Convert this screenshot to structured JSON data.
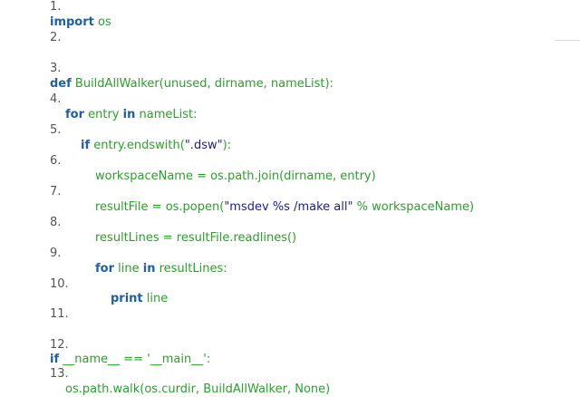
{
  "lines": [
    {
      "num": "1.",
      "parts": [],
      "indent": 0
    },
    {
      "num": "",
      "parts": [
        {
          "t": "import",
          "k": "kw"
        },
        {
          "t": " os",
          "k": "id"
        }
      ],
      "indent": 0
    },
    {
      "num": "2.",
      "parts": [],
      "indent": 0
    },
    {
      "num": "3.",
      "parts": [],
      "indent": 0
    },
    {
      "num": "",
      "parts": [
        {
          "t": "def",
          "k": "kw"
        },
        {
          "t": " BuildAllWalker(unused, dirname, nameList):",
          "k": "id"
        }
      ],
      "indent": 0
    },
    {
      "num": "4.",
      "parts": [],
      "indent": 0
    },
    {
      "num": "",
      "parts": [
        {
          "t": "for",
          "k": "kw"
        },
        {
          "t": " entry ",
          "k": "id"
        },
        {
          "t": "in",
          "k": "kw"
        },
        {
          "t": " nameList:",
          "k": "id"
        }
      ],
      "indent": 1
    },
    {
      "num": "5.",
      "parts": [],
      "indent": 0
    },
    {
      "num": "",
      "parts": [
        {
          "t": "if",
          "k": "kw"
        },
        {
          "t": " entry.endswith(",
          "k": "id"
        },
        {
          "t": "\".dsw\"",
          "k": "str"
        },
        {
          "t": "):",
          "k": "id"
        }
      ],
      "indent": 2
    },
    {
      "num": "6.",
      "parts": [],
      "indent": 0
    },
    {
      "num": "",
      "parts": [
        {
          "t": "workspaceName = os.path.join(dirname, entry)",
          "k": "id"
        }
      ],
      "indent": 3
    },
    {
      "num": "7.",
      "parts": [],
      "indent": 0
    },
    {
      "num": "",
      "parts": [
        {
          "t": "resultFile = os.popen(",
          "k": "id"
        },
        {
          "t": "\"msdev %s /make all\"",
          "k": "str"
        },
        {
          "t": " % workspaceName)",
          "k": "id"
        }
      ],
      "indent": 3
    },
    {
      "num": "8.",
      "parts": [],
      "indent": 0
    },
    {
      "num": "",
      "parts": [
        {
          "t": "resultLines = resultFile.readlines()",
          "k": "id"
        }
      ],
      "indent": 3
    },
    {
      "num": "9.",
      "parts": [],
      "indent": 0
    },
    {
      "num": "",
      "parts": [
        {
          "t": "for",
          "k": "kw"
        },
        {
          "t": " line ",
          "k": "id"
        },
        {
          "t": "in",
          "k": "kw"
        },
        {
          "t": " resultLines:",
          "k": "id"
        }
      ],
      "indent": 3
    },
    {
      "num": "10.",
      "parts": [],
      "indent": 0
    },
    {
      "num": "",
      "parts": [
        {
          "t": "print",
          "k": "kw"
        },
        {
          "t": " line",
          "k": "id"
        }
      ],
      "indent": 4
    },
    {
      "num": "11.",
      "parts": [],
      "indent": 0
    },
    {
      "num": "12.",
      "parts": [],
      "indent": 0
    },
    {
      "num": "",
      "parts": [
        {
          "t": "if",
          "k": "kw"
        },
        {
          "t": " __name__ == ",
          "k": "id"
        },
        {
          "t": "'__main__'",
          "k": "id"
        },
        {
          "t": ":",
          "k": "id"
        }
      ],
      "indent": 0
    },
    {
      "num": "13.",
      "parts": [],
      "indent": 0
    },
    {
      "num": "",
      "parts": [
        {
          "t": "os.path.walk(os.curdir, BuildAllWalker, None)",
          "k": "id"
        }
      ],
      "indent": 1
    }
  ]
}
